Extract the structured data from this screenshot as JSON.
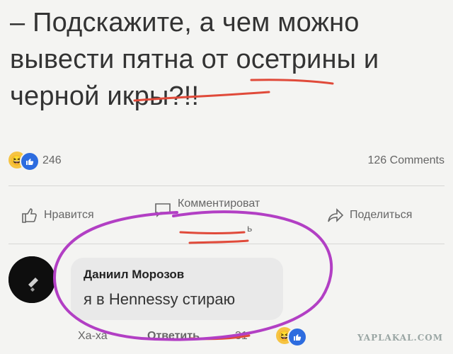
{
  "post": {
    "lines": [
      "– Подскажите, а чем можно",
      "вывести пятна от осетрины и",
      "черной икры?!!"
    ]
  },
  "stats": {
    "reaction_count": "246",
    "comments_count": "126 Comments"
  },
  "actions": {
    "like_label": "Нравится",
    "comment_label": "Комментироват",
    "comment_label_tail": "ь",
    "share_label": "Поделиться"
  },
  "comment": {
    "author": "Даниил Морозов",
    "text": "я в Hennessy стираю",
    "haha_label": "Ха-ха",
    "reply_label": "Ответить",
    "reaction_count": "31"
  },
  "watermark": "YAPLAKAL.COM",
  "colors": {
    "annotation": "#b23fc4",
    "underline": "#e04a3a",
    "like_blue": "#2d6cdf",
    "haha_yellow": "#f6c443"
  },
  "icons": {
    "haha": "laughing-face-icon",
    "like": "thumbs-up-icon",
    "comment": "speech-bubble-icon",
    "share": "share-arrow-icon"
  }
}
